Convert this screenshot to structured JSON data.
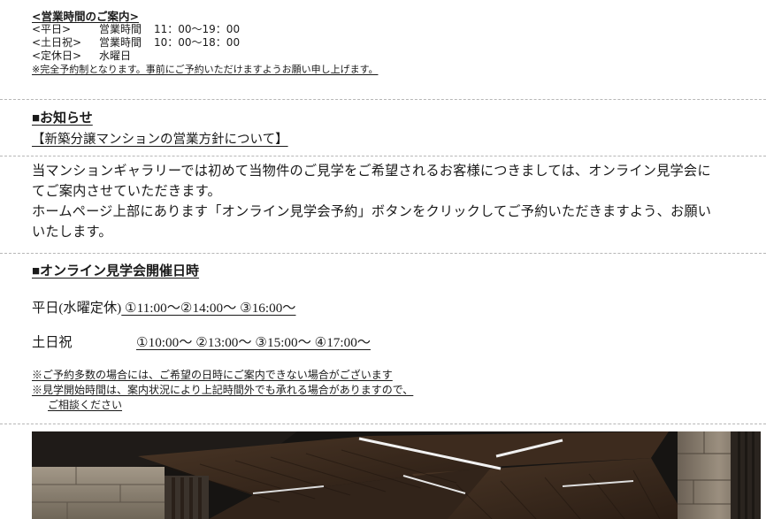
{
  "hours": {
    "title": "<営業時間のご案内>",
    "weekday": {
      "label": "<平日>",
      "name": "営業時間",
      "time": "11：00〜19：00"
    },
    "holiday": {
      "label": "<土日祝>",
      "name": "営業時間",
      "time": "10：00〜18：00"
    },
    "closed": {
      "label": "<定休日>",
      "value": "水曜日"
    },
    "note": "※完全予約制となります。事前にご予約いただけますようお願い申し上げます。"
  },
  "news": {
    "heading": "■お知らせ",
    "subheading": "【新築分譲マンションの営業方針について】",
    "lines": [
      "当マンションギャラリーでは初めて当物件のご見学をご希望されるお客様につきましては、オンライン見学会に",
      "てご案内させていただきます。",
      "ホームページ上部にあります「オンライン見学会予約」ボタンをクリックしてご予約いただきますよう、お願い",
      "いたします。"
    ]
  },
  "online": {
    "heading": "■オンライン見学会開催日時",
    "weekday": {
      "label": "平日(水曜定休)",
      "slots": " ①11:00〜②14:00〜 ③16:00〜"
    },
    "weekend": {
      "label": "土日祝",
      "slots": "①10:00〜 ②13:00〜 ③15:00〜 ④17:00〜"
    },
    "notes": [
      "※ご予約多数の場合には、ご希望の日時にご案内できない場合がございます",
      "※見学開始時間は、案内状況により上記時間外でも承れる場合がありますので、",
      "ご相談ください"
    ]
  },
  "colors": {
    "text": "#1a1a1a",
    "divider": "#b7b7b7",
    "ceiling_wood": "#3a2a1e",
    "stone": "#8e8478",
    "light": "#f2f2f2"
  }
}
